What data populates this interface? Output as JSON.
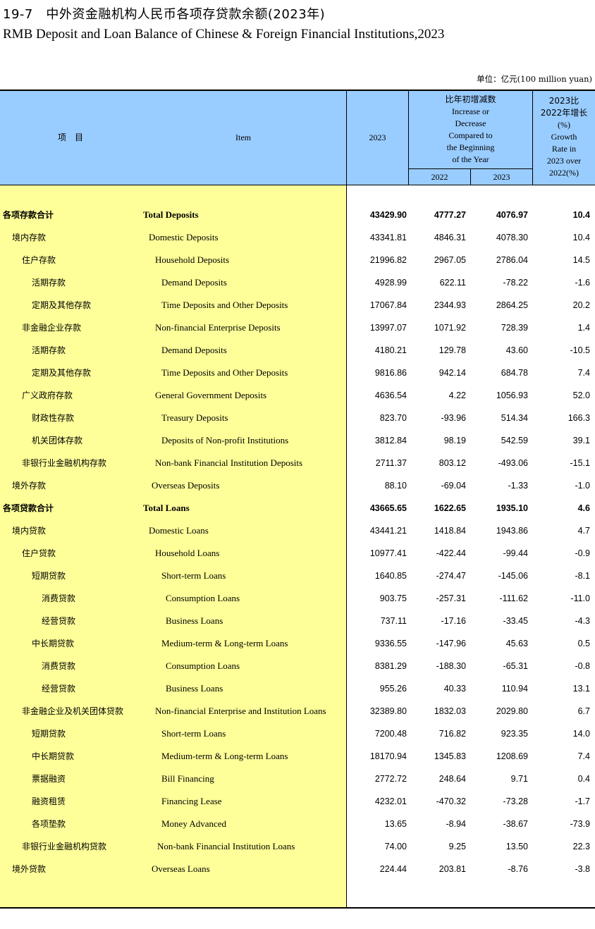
{
  "title_cn": "19-7　中外资金融机构人民币各项存贷款余额(2023年)",
  "title_en": "RMB Deposit and Loan Balance of Chinese & Foreign Financial Institutions,2023",
  "unit": "单位：亿元(100 million yuan)",
  "header": {
    "item_cn": "项　目",
    "item_en": "Item",
    "year": "2023",
    "change_lines": [
      "比年初增减数",
      "Increase or",
      "Decrease",
      "Compared to",
      "the Beginning",
      "of the Year"
    ],
    "sub_2022": "2022",
    "sub_2023": "2023",
    "growth_lines": [
      "2023比",
      "2022年增长",
      "(%)",
      "Growth",
      "Rate in",
      "2023 over",
      "2022(%)"
    ]
  },
  "colors": {
    "header_bg": "#99ccff",
    "label_bg": "#ffff99"
  },
  "rows": [
    {
      "cn": "各项存款合计",
      "en": "Total Deposits",
      "v2023": "43429.90",
      "i2022": "4777.27",
      "i2023": "4076.97",
      "g": "10.4",
      "bold": true,
      "lv": 0
    },
    {
      "cn": "境内存款",
      "en": "Domestic Deposits",
      "v2023": "43341.81",
      "i2022": "4846.31",
      "i2023": "4078.30",
      "g": "10.4",
      "lv": 1
    },
    {
      "cn": "住户存款",
      "en": "Household Deposits",
      "v2023": "21996.82",
      "i2022": "2967.05",
      "i2023": "2786.04",
      "g": "14.5",
      "lv": 2
    },
    {
      "cn": "活期存款",
      "en": "Demand  Deposits",
      "v2023": "4928.99",
      "i2022": "622.11",
      "i2023": "-78.22",
      "g": "-1.6",
      "lv": 3
    },
    {
      "cn": "定期及其他存款",
      "en": "Time Deposits and Other Deposits",
      "v2023": "17067.84",
      "i2022": "2344.93",
      "i2023": "2864.25",
      "g": "20.2",
      "lv": 3
    },
    {
      "cn": "非金融企业存款",
      "en": "Non-financial Enterprise Deposits",
      "v2023": "13997.07",
      "i2022": "1071.92",
      "i2023": "728.39",
      "g": "1.4",
      "lv": 2
    },
    {
      "cn": "活期存款",
      "en": "Demand  Deposits",
      "v2023": "4180.21",
      "i2022": "129.78",
      "i2023": "43.60",
      "g": "-10.5",
      "lv": 3
    },
    {
      "cn": "定期及其他存款",
      "en": "Time Deposits and Other Deposits",
      "v2023": "9816.86",
      "i2022": "942.14",
      "i2023": "684.78",
      "g": "7.4",
      "lv": 3
    },
    {
      "cn": "广义政府存款",
      "en": "General Government Deposits",
      "v2023": "4636.54",
      "i2022": "4.22",
      "i2023": "1056.93",
      "g": "52.0",
      "lv": 2
    },
    {
      "cn": "财政性存款",
      "en": "Treasury Deposits",
      "v2023": "823.70",
      "i2022": "-93.96",
      "i2023": "514.34",
      "g": "166.3",
      "lv": 3
    },
    {
      "cn": "机关团体存款",
      "en": "Deposits of Non-profit Institutions",
      "v2023": "3812.84",
      "i2022": "98.19",
      "i2023": "542.59",
      "g": "39.1",
      "lv": 3
    },
    {
      "cn": "非银行业金融机构存款",
      "en": "Non-bank Financial Institution Deposits",
      "v2023": "2711.37",
      "i2022": "803.12",
      "i2023": "-493.06",
      "g": "-15.1",
      "lv": 2
    },
    {
      "cn": "境外存款",
      "en": "Overseas Deposits",
      "v2023": "88.10",
      "i2022": "-69.04",
      "i2023": "-1.33",
      "g": "-1.0",
      "lv": 1
    },
    {
      "cn": "各项贷款合计",
      "en": "Total Loans",
      "v2023": "43665.65",
      "i2022": "1622.65",
      "i2023": "1935.10",
      "g": "4.6",
      "bold": true,
      "lv": 0
    },
    {
      "cn": "境内贷款",
      "en": "Domestic Loans",
      "v2023": "43441.21",
      "i2022": "1418.84",
      "i2023": "1943.86",
      "g": "4.7",
      "lv": 1
    },
    {
      "cn": "住户贷款",
      "en": "Household Loans",
      "v2023": "10977.41",
      "i2022": "-422.44",
      "i2023": "-99.44",
      "g": "-0.9",
      "lv": 2
    },
    {
      "cn": "短期贷款",
      "en": "Short-term Loans",
      "v2023": "1640.85",
      "i2022": "-274.47",
      "i2023": "-145.06",
      "g": "-8.1",
      "lv": 3
    },
    {
      "cn": "消费贷款",
      "en": "Consumption Loans",
      "v2023": "903.75",
      "i2022": "-257.31",
      "i2023": "-111.62",
      "g": "-11.0",
      "lv": 4
    },
    {
      "cn": "经营贷款",
      "en": "Business Loans",
      "v2023": "737.11",
      "i2022": "-17.16",
      "i2023": "-33.45",
      "g": "-4.3",
      "lv": 4
    },
    {
      "cn": "中长期贷款",
      "en": "Medium-term & Long-term Loans",
      "v2023": "9336.55",
      "i2022": "-147.96",
      "i2023": "45.63",
      "g": "0.5",
      "lv": 3
    },
    {
      "cn": "消费贷款",
      "en": "Consumption Loans",
      "v2023": "8381.29",
      "i2022": "-188.30",
      "i2023": "-65.31",
      "g": "-0.8",
      "lv": 4
    },
    {
      "cn": "经营贷款",
      "en": "Business Loans",
      "v2023": "955.26",
      "i2022": "40.33",
      "i2023": "110.94",
      "g": "13.1",
      "lv": 4
    },
    {
      "cn": "非金融企业及机关团体贷款",
      "en": "Non-financial Enterprise and Institution Loans",
      "v2023": "32389.80",
      "i2022": "1832.03",
      "i2023": "2029.80",
      "g": "6.7",
      "lv": 2
    },
    {
      "cn": "短期贷款",
      "en": "Short-term Loans",
      "v2023": "7200.48",
      "i2022": "716.82",
      "i2023": "923.35",
      "g": "14.0",
      "lv": 3
    },
    {
      "cn": "中长期贷款",
      "en": "Medium-term & Long-term Loans",
      "v2023": "18170.94",
      "i2022": "1345.83",
      "i2023": "1208.69",
      "g": "7.4",
      "lv": 3
    },
    {
      "cn": "票据融资",
      "en": "Bill Financing",
      "v2023": "2772.72",
      "i2022": "248.64",
      "i2023": "9.71",
      "g": "0.4",
      "lv": 3
    },
    {
      "cn": "融资租赁",
      "en": "Financing Lease",
      "v2023": "4232.01",
      "i2022": "-470.32",
      "i2023": "-73.28",
      "g": "-1.7",
      "lv": 3
    },
    {
      "cn": "各项垫款",
      "en": "Money Advanced",
      "v2023": "13.65",
      "i2022": "-8.94",
      "i2023": "-38.67",
      "g": "-73.9",
      "lv": 3
    },
    {
      "cn": "非银行业金融机构贷款",
      "en": "Non-bank Financial Institution Loans",
      "v2023": "74.00",
      "i2022": "9.25",
      "i2023": "13.50",
      "g": "22.3",
      "lv": 2,
      "en_shift": 1
    },
    {
      "cn": "境外贷款",
      "en": "Overseas Loans",
      "v2023": "224.44",
      "i2022": "203.81",
      "i2023": "-8.76",
      "g": "-3.8",
      "lv": 1
    }
  ]
}
